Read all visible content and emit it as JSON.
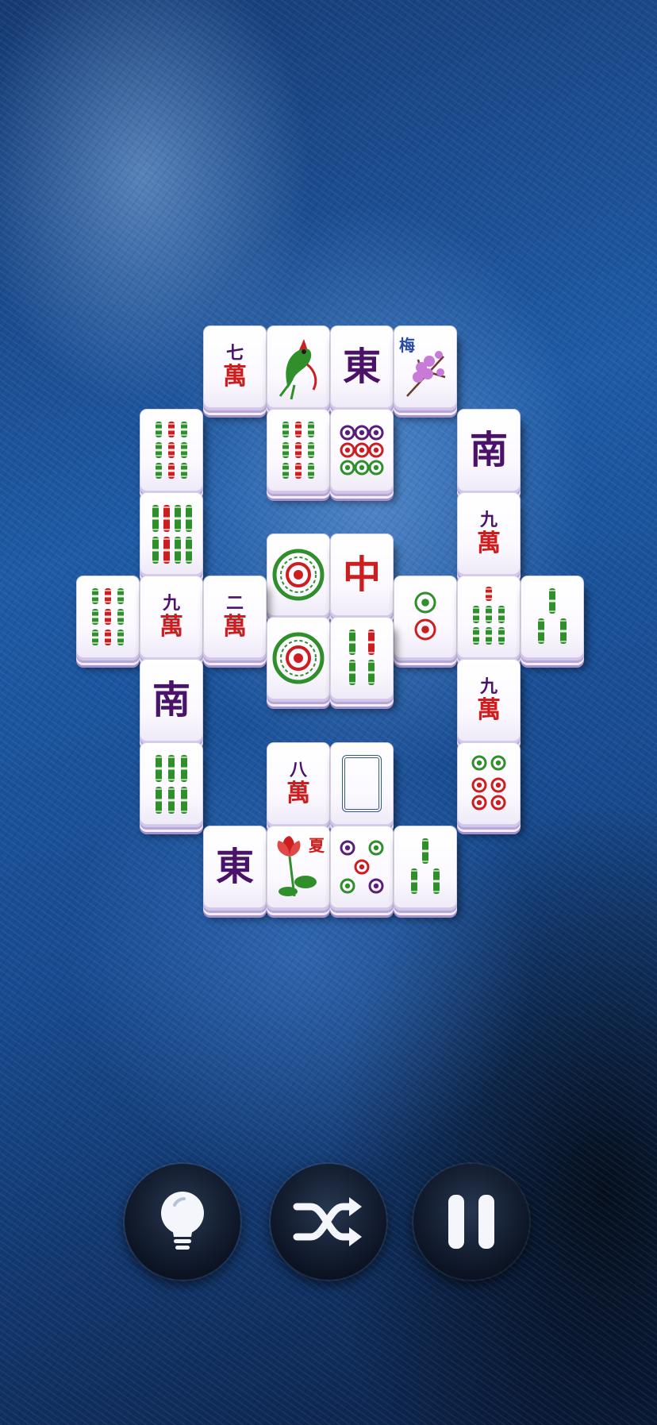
{
  "screen": "mahjong-solitaire-board",
  "controls": [
    {
      "id": "hint",
      "name": "hint-button",
      "icon": "lightbulb-icon"
    },
    {
      "id": "shuffle",
      "name": "shuffle-button",
      "icon": "shuffle-icon"
    },
    {
      "id": "pause",
      "name": "pause-button",
      "icon": "pause-icon"
    }
  ],
  "tiles": [
    {
      "kind": "char",
      "num": "七"
    },
    {
      "kind": "bam1"
    },
    {
      "kind": "wind",
      "text": "東"
    },
    {
      "kind": "plum",
      "label": "梅"
    },
    {
      "kind": "bam",
      "n": 9
    },
    {
      "kind": "bam",
      "n": 9
    },
    {
      "kind": "circ",
      "n": 9
    },
    {
      "kind": "wind",
      "text": "南"
    },
    {
      "kind": "bam",
      "n": 8
    },
    {
      "kind": "char",
      "num": "九"
    },
    {
      "kind": "circ1"
    },
    {
      "kind": "dragon",
      "text": "中"
    },
    {
      "kind": "bam",
      "n": 9
    },
    {
      "kind": "char",
      "num": "九"
    },
    {
      "kind": "char",
      "num": "二"
    },
    {
      "kind": "circ",
      "n": 2
    },
    {
      "kind": "bam",
      "n": 7
    },
    {
      "kind": "bam",
      "n": 3
    },
    {
      "kind": "circ1"
    },
    {
      "kind": "bam",
      "n": 4
    },
    {
      "kind": "wind",
      "text": "南"
    },
    {
      "kind": "char",
      "num": "九"
    },
    {
      "kind": "bam",
      "n": 6
    },
    {
      "kind": "char",
      "num": "八"
    },
    {
      "kind": "white"
    },
    {
      "kind": "circ",
      "n": 6
    },
    {
      "kind": "wind",
      "text": "東"
    },
    {
      "kind": "summer",
      "label": "夏"
    },
    {
      "kind": "circ",
      "n": 5
    },
    {
      "kind": "bam",
      "n": 3
    }
  ]
}
